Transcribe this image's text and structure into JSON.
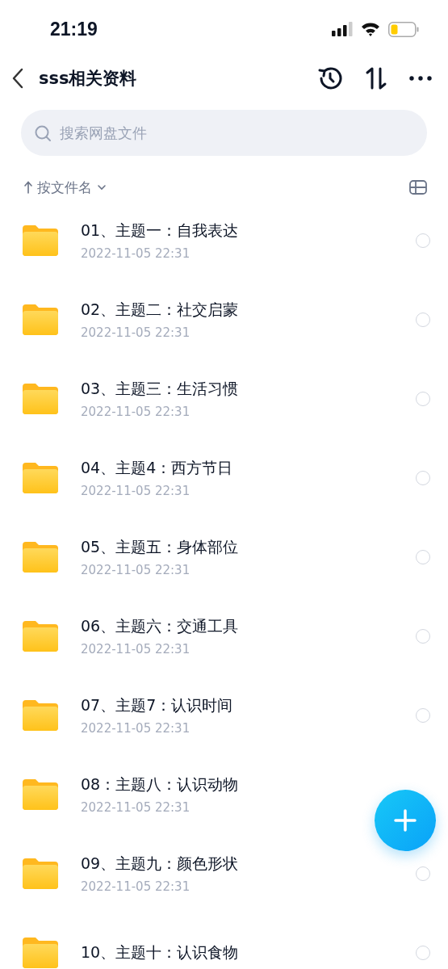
{
  "status_bar": {
    "time": "21:19"
  },
  "nav": {
    "title": "sss相关资料"
  },
  "search": {
    "placeholder": "搜索网盘文件"
  },
  "sort": {
    "label": "按文件名"
  },
  "files": [
    {
      "name": "01、主题一：自我表达",
      "date": "2022-11-05 22:31",
      "selected": false
    },
    {
      "name": "02、主题二：社交启蒙",
      "date": "2022-11-05 22:31",
      "selected": false
    },
    {
      "name": "03、主题三：生活习惯",
      "date": "2022-11-05 22:31",
      "selected": false
    },
    {
      "name": "04、主题4：西方节日",
      "date": "2022-11-05 22:31",
      "selected": false
    },
    {
      "name": "05、主题五：身体部位",
      "date": "2022-11-05 22:31",
      "selected": false
    },
    {
      "name": "06、主题六：交通工具",
      "date": "2022-11-05 22:31",
      "selected": false
    },
    {
      "name": "07、主题7：认识时间",
      "date": "2022-11-05 22:31",
      "selected": false
    },
    {
      "name": "08：主题八：认识动物",
      "date": "2022-11-05 22:31"
    },
    {
      "name": "09、主题九：颜色形状",
      "date": "2022-11-05 22:31",
      "selected": false
    },
    {
      "name": "10、主题十：认识食物",
      "selected": false
    }
  ]
}
